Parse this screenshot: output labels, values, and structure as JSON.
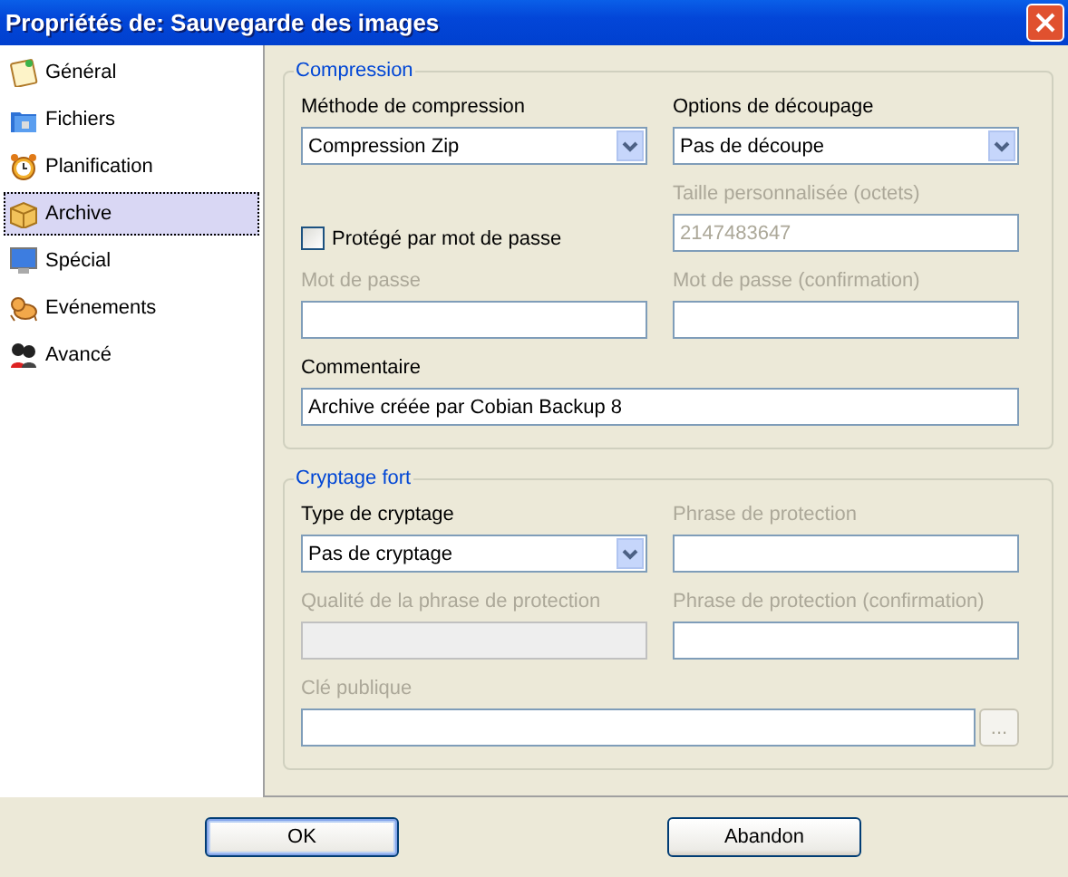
{
  "window": {
    "title": "Propriétés de: Sauvegarde des images"
  },
  "sidebar": {
    "items": [
      {
        "label": "Général",
        "selected": false
      },
      {
        "label": "Fichiers",
        "selected": false
      },
      {
        "label": "Planification",
        "selected": false
      },
      {
        "label": "Archive",
        "selected": true
      },
      {
        "label": "Spécial",
        "selected": false
      },
      {
        "label": "Evénements",
        "selected": false
      },
      {
        "label": "Avancé",
        "selected": false
      }
    ]
  },
  "groups": [
    {
      "title": "Compression",
      "fields": [
        {
          "kind": "combo",
          "label": "Méthode de compression",
          "value": "Compression Zip",
          "disabled": false
        },
        {
          "kind": "combo",
          "label": "Options de découpage",
          "value": "Pas de découpe",
          "disabled": false
        },
        {
          "kind": "checkbox",
          "label": "Protégé par mot de passe",
          "checked": false
        },
        {
          "kind": "text",
          "label": "Taille personnalisée (octets)",
          "value": "2147483647",
          "disabled": true
        },
        {
          "kind": "text",
          "label": "Mot de passe",
          "disabled": true
        },
        {
          "kind": "text",
          "label": "Mot de passe (confirmation)",
          "disabled": true
        },
        {
          "kind": "wide",
          "label": "Commentaire",
          "value": "Archive créée par Cobian Backup 8",
          "disabled": false
        }
      ]
    },
    {
      "title": "Cryptage fort",
      "fields": [
        {
          "kind": "combo",
          "label": "Type de cryptage",
          "value": "Pas de cryptage",
          "disabled": false
        },
        {
          "kind": "text",
          "label": "Phrase de protection",
          "disabled": true
        },
        {
          "kind": "meter",
          "label": "Qualité de la phrase de protection",
          "disabled": true
        },
        {
          "kind": "text",
          "label": "Phrase de protection (confirmation)",
          "disabled": true
        },
        {
          "kind": "browse",
          "label": "Clé publique",
          "button": "...",
          "disabled": true
        }
      ]
    }
  ],
  "buttons": [
    {
      "label": "OK",
      "default": true
    },
    {
      "label": "Abandon",
      "default": false
    }
  ]
}
